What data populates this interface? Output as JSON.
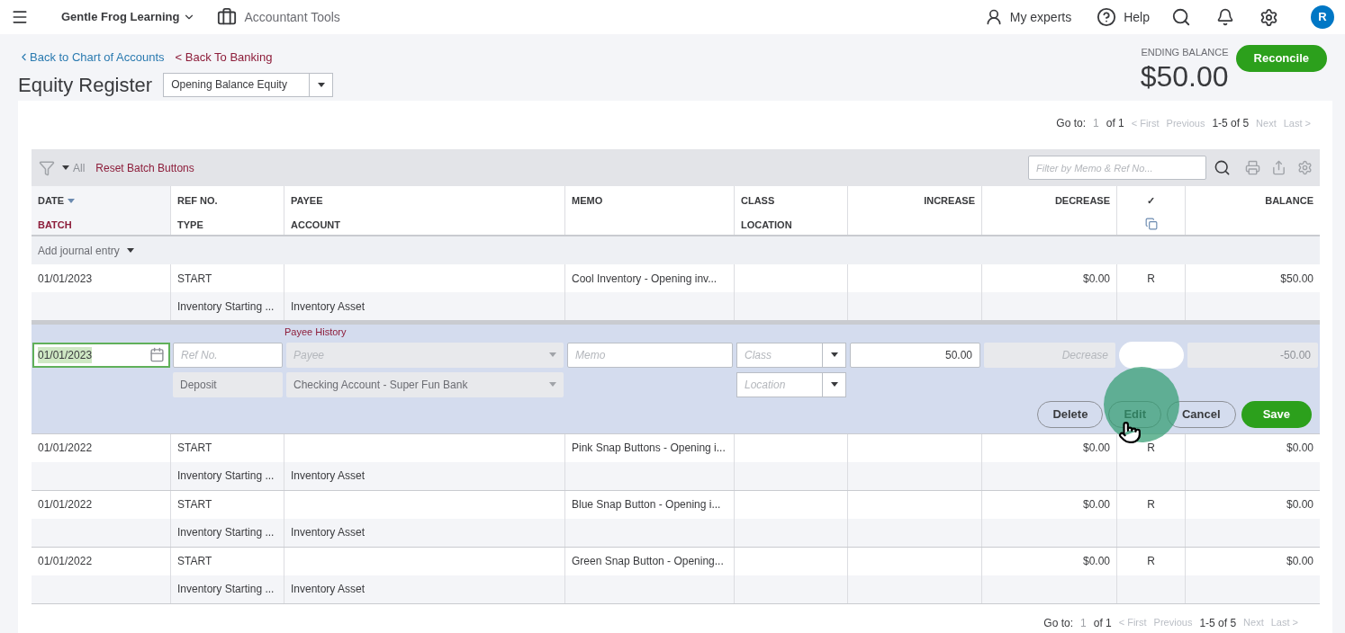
{
  "topbar": {
    "company": "Gentle Frog Learning",
    "tools": "Accountant Tools",
    "experts": "My experts",
    "help": "Help",
    "avatar": "R"
  },
  "header": {
    "back_links": [
      "Back to Chart of Accounts",
      "< Back To Banking"
    ],
    "title": "Equity Register",
    "account": "Opening Balance Equity",
    "ending_label": "ENDING BALANCE",
    "ending_value": "$50.00",
    "reconcile": "Reconcile"
  },
  "pagination_top": {
    "goto": "Go to:",
    "page": "1",
    "of": "of 1",
    "first": "< First",
    "previous": "Previous",
    "range": "1-5 of 5",
    "next": "Next",
    "last": "Last >"
  },
  "toolbar": {
    "filter": "All",
    "reset": "Reset Batch Buttons",
    "search_placeholder": "Filter by Memo & Ref No..."
  },
  "columns": [
    {
      "top": "DATE",
      "bottom": "BATCH",
      "sorted": true,
      "kind": "text"
    },
    {
      "top": "REF NO.",
      "bottom": "TYPE",
      "sorted": false,
      "kind": "text"
    },
    {
      "top": "PAYEE",
      "bottom": "ACCOUNT",
      "sorted": false,
      "kind": "text"
    },
    {
      "top": "MEMO",
      "sorted": false,
      "kind": "text"
    },
    {
      "top": "CLASS",
      "bottom": "LOCATION",
      "sorted": false,
      "kind": "text"
    },
    {
      "top": "INCREASE",
      "sorted": false,
      "kind": "amount"
    },
    {
      "top": "DECREASE",
      "sorted": false,
      "kind": "amount"
    },
    {
      "top": "✓",
      "sorted": false,
      "kind": "check"
    },
    {
      "top": "BALANCE",
      "sorted": false,
      "kind": "amount"
    }
  ],
  "add_entry": "Add journal entry",
  "rows": [
    {
      "kind": "transaction",
      "date": "01/01/2023",
      "ref": "START",
      "type": "Inventory Starting ...",
      "account": "Inventory Asset",
      "memo": "Cool Inventory - Opening inv...",
      "decrease": "$0.00",
      "status": "R",
      "balance": "$50.00"
    },
    {
      "kind": "editing",
      "payee_history": "Payee History",
      "date": "01/01/2023",
      "ref_placeholder": "Ref No.",
      "payee_placeholder": "Payee",
      "memo_placeholder": "Memo",
      "class_placeholder": "Class",
      "increase": "50.00",
      "decrease_placeholder": "Decrease",
      "reconciled": false,
      "balance": "-50.00",
      "type": "Deposit",
      "account": "Checking Account - Super Fun Bank",
      "location_placeholder": "Location",
      "buttons": [
        {
          "label": "Delete",
          "kind": "outline"
        },
        {
          "label": "Edit",
          "kind": "outline"
        },
        {
          "label": "Cancel",
          "kind": "outline"
        },
        {
          "label": "Save",
          "kind": "primary"
        }
      ]
    },
    {
      "kind": "transaction",
      "date": "01/01/2022",
      "ref": "START",
      "type": "Inventory Starting ...",
      "account": "Inventory Asset",
      "memo": "Pink Snap Buttons - Opening i...",
      "decrease": "$0.00",
      "status": "R",
      "balance": "$0.00"
    },
    {
      "kind": "transaction",
      "date": "01/01/2022",
      "ref": "START",
      "type": "Inventory Starting ...",
      "account": "Inventory Asset",
      "memo": "Blue Snap Button - Opening i...",
      "decrease": "$0.00",
      "status": "R",
      "balance": "$0.00"
    },
    {
      "kind": "transaction",
      "date": "01/01/2022",
      "ref": "START",
      "type": "Inventory Starting ...",
      "account": "Inventory Asset",
      "memo": "Green Snap Button - Opening...",
      "decrease": "$0.00",
      "status": "R",
      "balance": "$0.00"
    }
  ],
  "pagination_bottom": {
    "goto": "Go to:",
    "page": "1",
    "of": "of 1",
    "first": "< First",
    "previous": "Previous",
    "range": "1-5 of 5",
    "next": "Next",
    "last": "Last >"
  }
}
